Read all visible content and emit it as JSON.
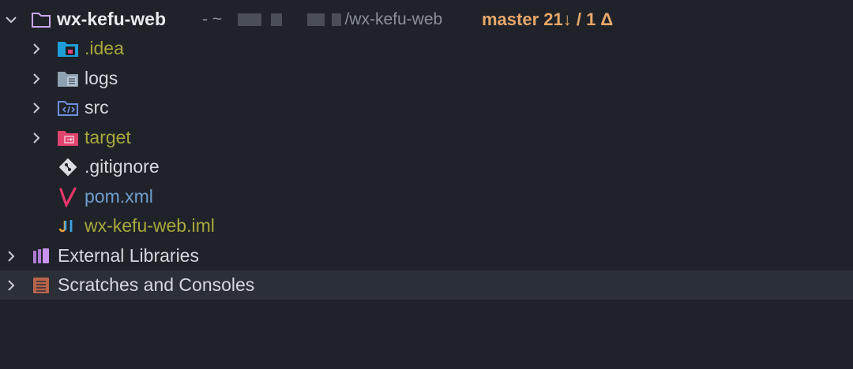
{
  "project": {
    "name": "wx-kefu-web",
    "path_prefix": "- ~",
    "path_suffix": "/wx-kefu-web",
    "branch_status": "master 21↓ / 1 Δ"
  },
  "items": [
    {
      "label": ".idea",
      "icon": "idea-folder-icon",
      "expanded": false
    },
    {
      "label": "logs",
      "icon": "logs-folder-icon",
      "expanded": false
    },
    {
      "label": "src",
      "icon": "source-folder-icon",
      "expanded": false
    },
    {
      "label": "target",
      "icon": "excluded-folder-icon",
      "expanded": false
    },
    {
      "label": ".gitignore",
      "icon": "git-icon"
    },
    {
      "label": "pom.xml",
      "icon": "maven-icon"
    },
    {
      "label": "wx-kefu-web.iml",
      "icon": "iml-icon"
    }
  ],
  "external_libraries": "External Libraries",
  "scratches": "Scratches and Consoles",
  "colors": {
    "background": "#1f2329",
    "selection": "#2b2f36",
    "branch": "#e8a86a",
    "ignored_text": "#a8a83c",
    "modified_text": "#6f9dcf"
  }
}
